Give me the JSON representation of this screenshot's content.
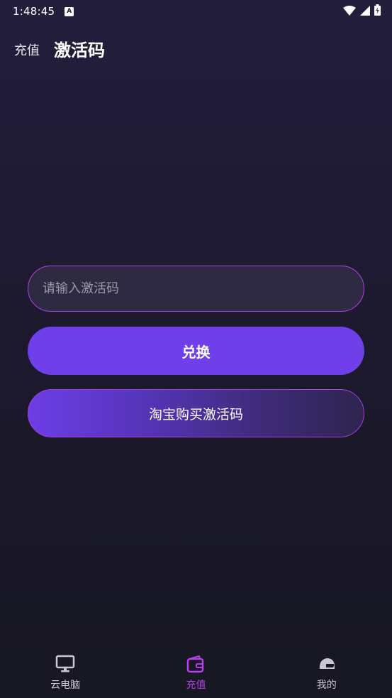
{
  "status_bar": {
    "time": "1:48:45",
    "notification_letter": "A"
  },
  "header": {
    "recharge_tab": "充值",
    "title": "激活码"
  },
  "form": {
    "code_placeholder": "请输入激活码",
    "code_value": "",
    "redeem_label": "兑换",
    "buy_label": "淘宝购买激活码"
  },
  "bottom_nav": {
    "items": [
      {
        "label": "云电脑",
        "icon": "monitor-icon",
        "active": false
      },
      {
        "label": "充值",
        "icon": "wallet-icon",
        "active": true
      },
      {
        "label": "我的",
        "icon": "helmet-icon",
        "active": false
      }
    ]
  },
  "colors": {
    "accent": "#b440ea",
    "button_primary": "#6f40ea",
    "background_top": "#231e3c",
    "background_bottom": "#171622"
  }
}
